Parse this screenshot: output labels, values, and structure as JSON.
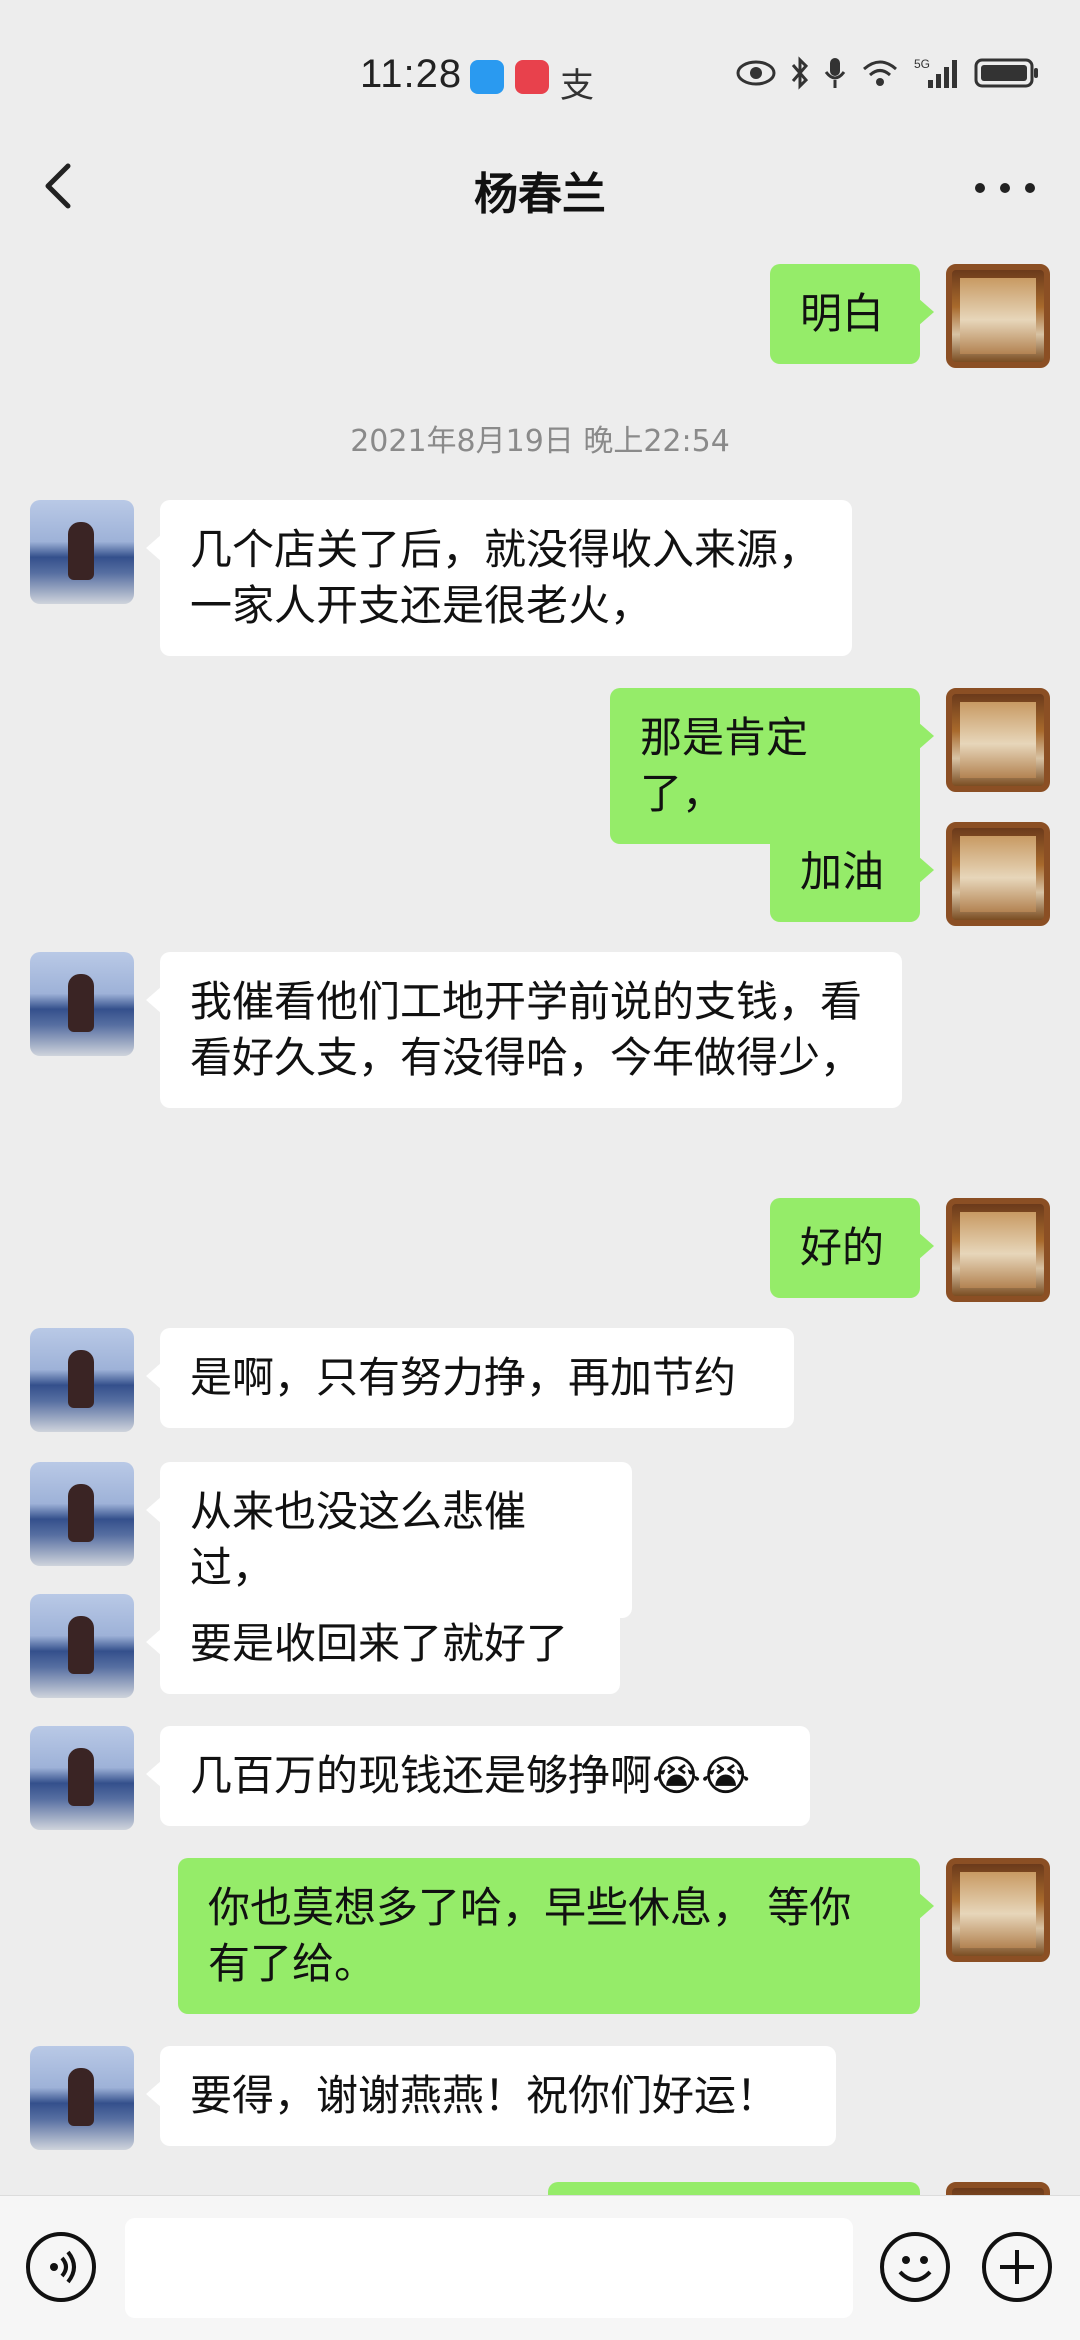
{
  "status_bar": {
    "time": "11:28",
    "app_label": "支",
    "network": "5G"
  },
  "header": {
    "title": "杨春兰"
  },
  "messages": [
    {
      "side": "out",
      "text": "明白"
    },
    {
      "type": "timestamp",
      "text": "2021年8月19日 晚上22:54"
    },
    {
      "side": "in",
      "text": "几个店关了后，就没得收入来源，一家人开支还是很老火，"
    },
    {
      "side": "out",
      "text": "那是肯定了，"
    },
    {
      "side": "out",
      "text": "加油"
    },
    {
      "side": "in",
      "text": "我催看他们工地开学前说的支钱，看看好久支，有没得哈，今年做得少，"
    },
    {
      "side": "out",
      "text": "好的"
    },
    {
      "side": "in",
      "text": "是啊，只有努力挣，再加节约"
    },
    {
      "side": "in",
      "text": "从来也没这么悲催过，"
    },
    {
      "side": "in",
      "text": "要是收回来了就好了"
    },
    {
      "side": "in",
      "text": "几百万的现钱还是够挣啊😭😭"
    },
    {
      "side": "out",
      "text": "你也莫想多了哈，早些休息， 等你有了给。"
    },
    {
      "side": "in",
      "text": "要得，谢谢燕燕！祝你们好运！"
    }
  ],
  "input": {
    "value": ""
  },
  "icons": {
    "back": "chevron-left-icon",
    "more": "more-dots-icon",
    "voice": "voice-icon",
    "emoji": "emoji-icon",
    "plus": "plus-icon"
  },
  "colors": {
    "outgoing_bubble": "#95ec69",
    "incoming_bubble": "#ffffff",
    "background": "#ededed"
  }
}
